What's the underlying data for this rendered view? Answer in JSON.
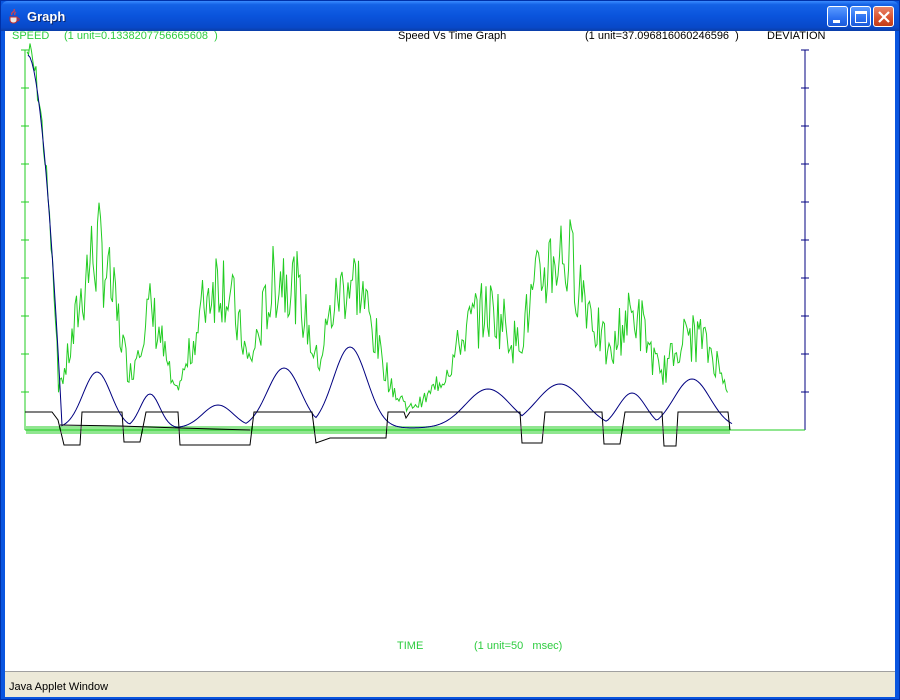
{
  "window": {
    "title": "Graph",
    "status": "Java Applet Window"
  },
  "graph": {
    "left_label": "SPEED",
    "left_unit": "(1 unit=0.1338207756665608  )",
    "title": "Speed Vs Time Graph",
    "right_unit": "(1 unit=37.096816060246596  )",
    "right_label": "DEVIATION",
    "x_label": "TIME",
    "x_unit": "(1 unit=50   msec)"
  },
  "colors": {
    "speed": "#22cc22",
    "deviation_axis": "#000080",
    "smooth": "#000080",
    "step": "#000000"
  }
}
